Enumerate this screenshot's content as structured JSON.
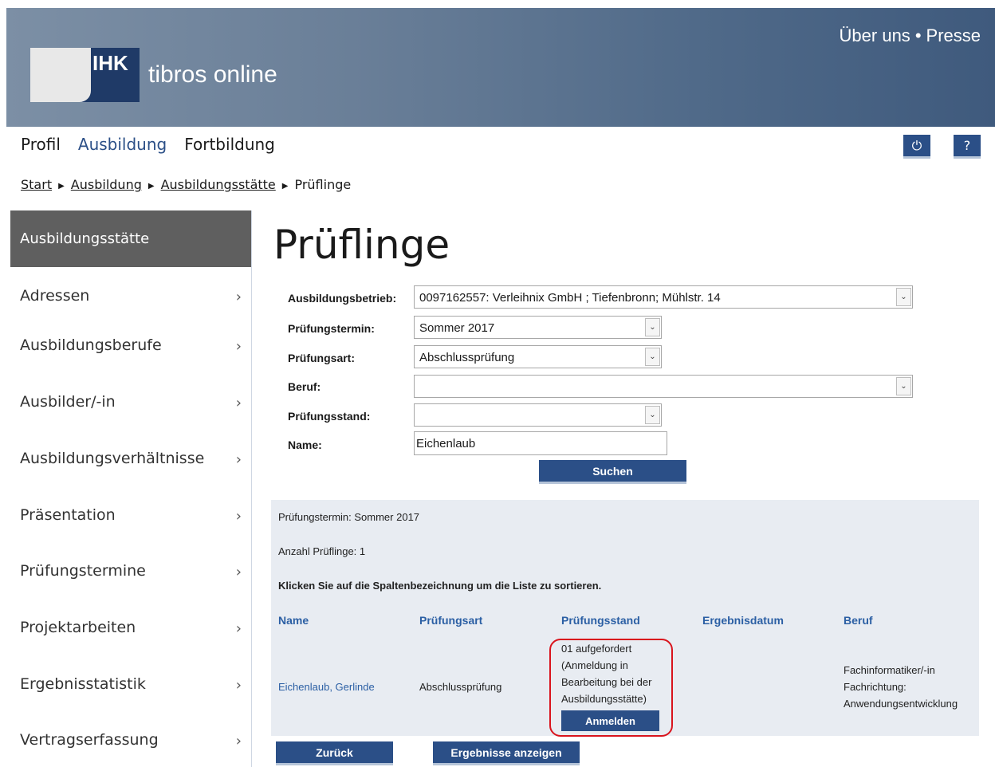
{
  "header": {
    "logo_abbr": "IHK",
    "app_title": "tibros online",
    "links": [
      "Über uns",
      "Presse"
    ],
    "separator": "•",
    "brand_color": "#2b4f87"
  },
  "mainnav": {
    "items": [
      "Profil",
      "Ausbildung",
      "Fortbildung"
    ],
    "active": "Ausbildung",
    "logout_icon": "⏻",
    "help_icon": "?"
  },
  "breadcrumb": {
    "items": [
      "Start",
      "Ausbildung",
      "Ausbildungsstätte"
    ],
    "current": "Prüflinge"
  },
  "sidebar": {
    "title": "Ausbildungsstätte",
    "items": [
      "Adressen",
      "Ausbildungsberufe",
      "Ausbilder/-in",
      "Ausbildungsverhältnisse",
      "Präsentation",
      "Prüfungstermine",
      "Projektarbeiten",
      "Ergebnisstatistik",
      "Vertragserfassung"
    ],
    "chevron": "›"
  },
  "page": {
    "title": "Prüflinge"
  },
  "form": {
    "betrieb_label": "Ausbildungsbetrieb:",
    "betrieb_value": "0097162557: Verleihnix GmbH ; Tiefenbronn; Mühlstr. 14",
    "termin_label": "Prüfungstermin:",
    "termin_value": "Sommer 2017",
    "art_label": "Prüfungsart:",
    "art_value": "Abschlussprüfung",
    "beruf_label": "Beruf:",
    "beruf_value": "",
    "stand_label": "Prüfungsstand:",
    "stand_value": "",
    "name_label": "Name:",
    "name_value": "Eichenlaub",
    "search_button": "Suchen",
    "dropdown_arrow": "⌄"
  },
  "results": {
    "termin_line": "Prüfungstermin: Sommer 2017",
    "count_line": "Anzahl Prüflinge: 1",
    "sort_hint": "Klicken Sie auf die Spaltenbezeichnung um die Liste zu sortieren.",
    "columns": [
      "Name",
      "Prüfungsart",
      "Prüfungsstand",
      "Ergebnisdatum",
      "Beruf"
    ],
    "rows": [
      {
        "name": "Eichenlaub, Gerlinde",
        "art": "Abschlussprüfung",
        "stand_lines": [
          "01 aufgefordert",
          "(Anmeldung in",
          "Bearbeitung bei der",
          "Ausbildungsstätte)"
        ],
        "stand_button": "Anmelden",
        "ergebnisdatum": "",
        "beruf_lines": [
          "Fachinformatiker/-in",
          "Fachrichtung:",
          "Anwendungsentwicklung"
        ]
      }
    ],
    "highlight_color": "#d9141d"
  },
  "footer_buttons": {
    "back": "Zurück",
    "show_results": "Ergebnisse anzeigen"
  }
}
